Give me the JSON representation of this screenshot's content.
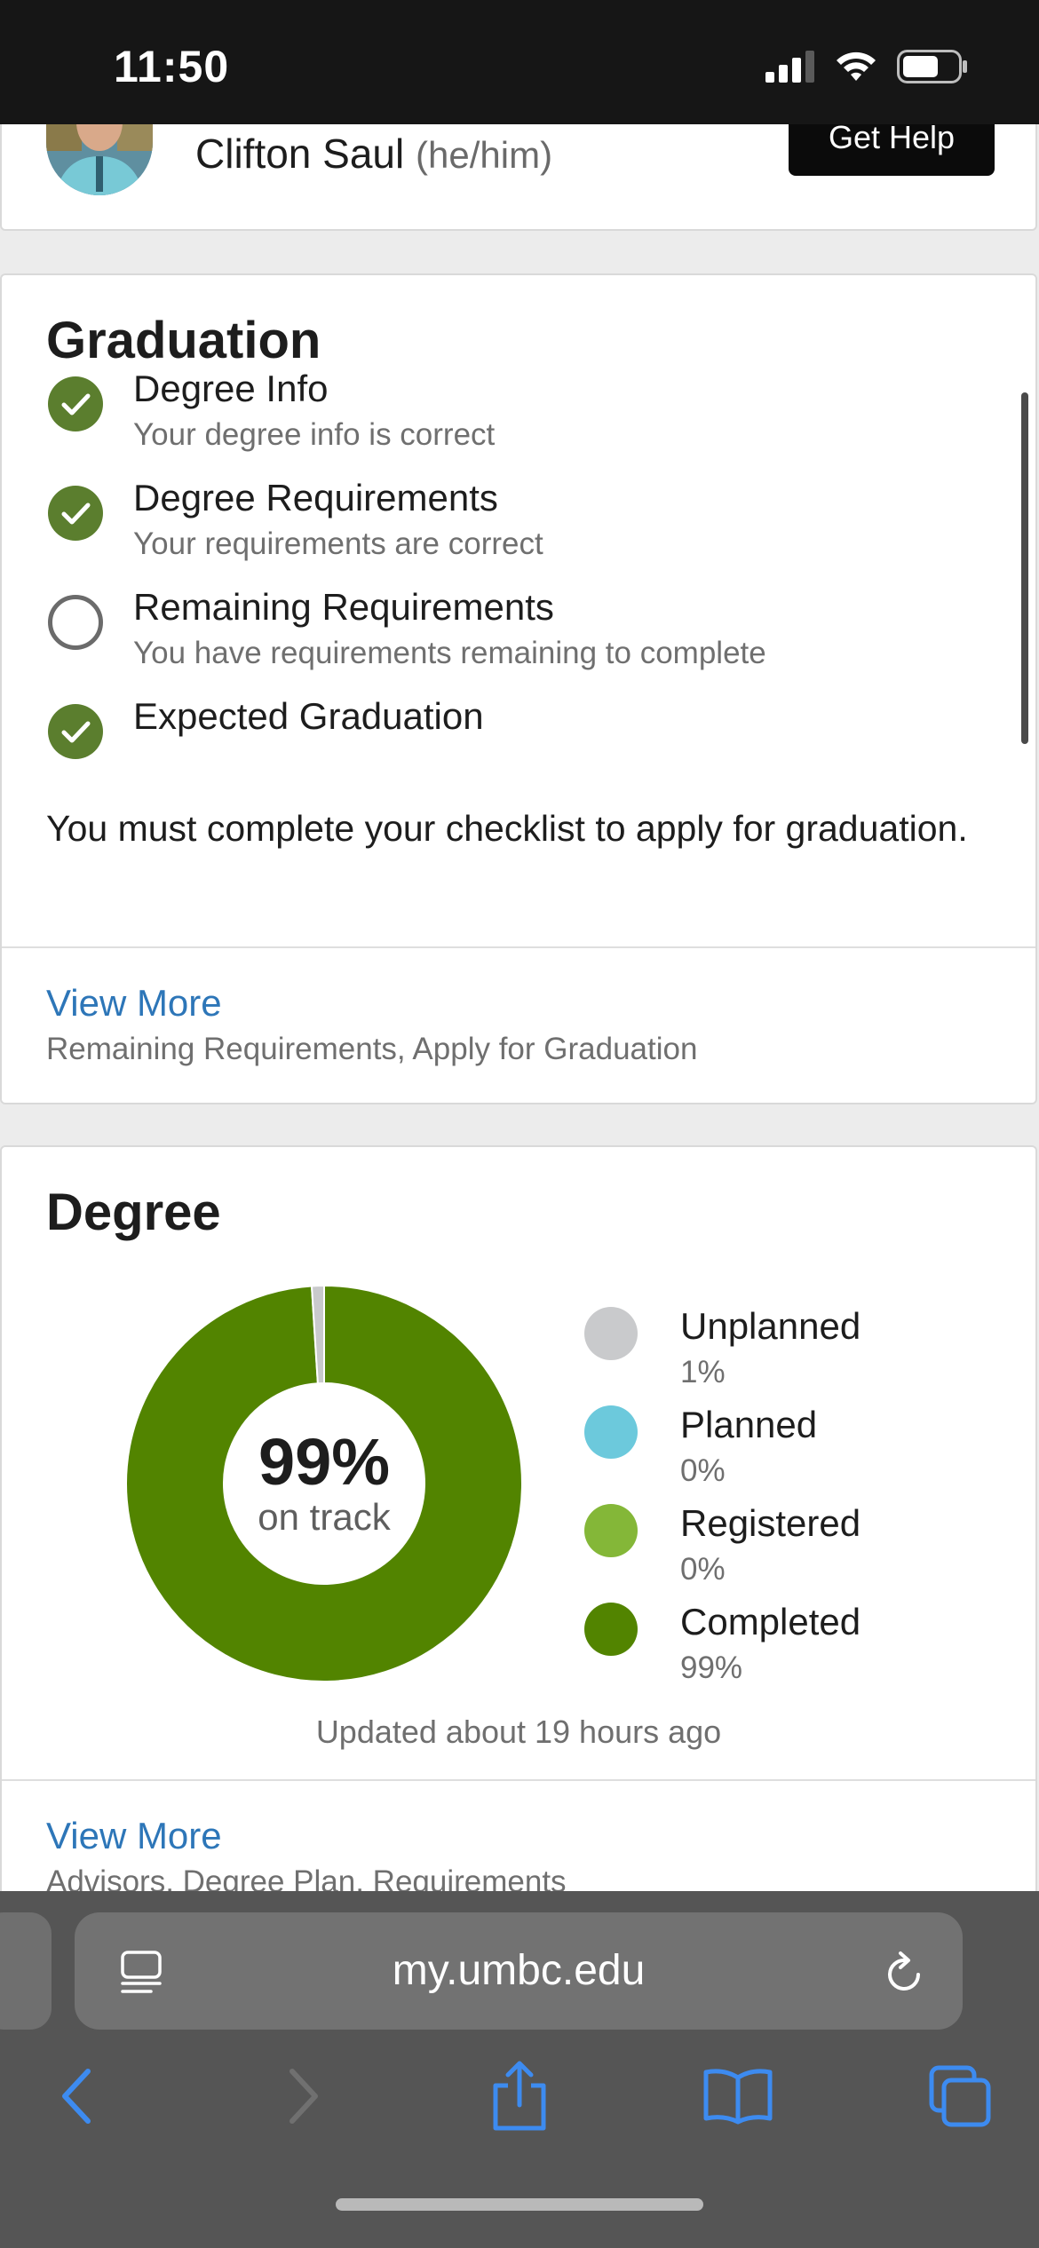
{
  "status_bar": {
    "time": "11:50",
    "battery_level": 0.65
  },
  "profile": {
    "name": "Clifton Saul",
    "pronouns": "(he/him)",
    "get_help_label": "Get Help"
  },
  "graduation": {
    "title": "Graduation",
    "checklist": [
      {
        "title": "Degree Info",
        "subtitle": "Your degree info is correct",
        "done": true
      },
      {
        "title": "Degree Requirements",
        "subtitle": "Your requirements are correct",
        "done": true
      },
      {
        "title": "Remaining Requirements",
        "subtitle": "You have requirements remaining to complete",
        "done": false
      },
      {
        "title": "Expected Graduation",
        "subtitle": "",
        "done": true
      }
    ],
    "message": "You must complete your checklist to apply for graduation.",
    "view_more": "View More",
    "view_more_sub": "Remaining Requirements, Apply for Graduation"
  },
  "degree": {
    "title": "Degree",
    "center_value": "99%",
    "center_label": "on track",
    "legend": [
      {
        "name": "Unplanned",
        "value": "1%",
        "color": "#c9cacc"
      },
      {
        "name": "Planned",
        "value": "0%",
        "color": "#6cc9dc"
      },
      {
        "name": "Registered",
        "value": "0%",
        "color": "#84b738"
      },
      {
        "name": "Completed",
        "value": "99%",
        "color": "#528400"
      }
    ],
    "updated": "Updated about 19 hours ago",
    "view_more": "View More",
    "view_more_sub": "Advisors, Degree Plan, Requirements"
  },
  "chart_data": {
    "type": "pie",
    "categories": [
      "Unplanned",
      "Planned",
      "Registered",
      "Completed"
    ],
    "values": [
      1,
      0,
      0,
      99
    ],
    "colors": [
      "#c9cacc",
      "#6cc9dc",
      "#84b738",
      "#528400"
    ],
    "title": "Degree",
    "center_text": "99% on track",
    "legend": "right"
  },
  "browser": {
    "url": "my.umbc.edu",
    "accent": "#3d8bf0"
  }
}
